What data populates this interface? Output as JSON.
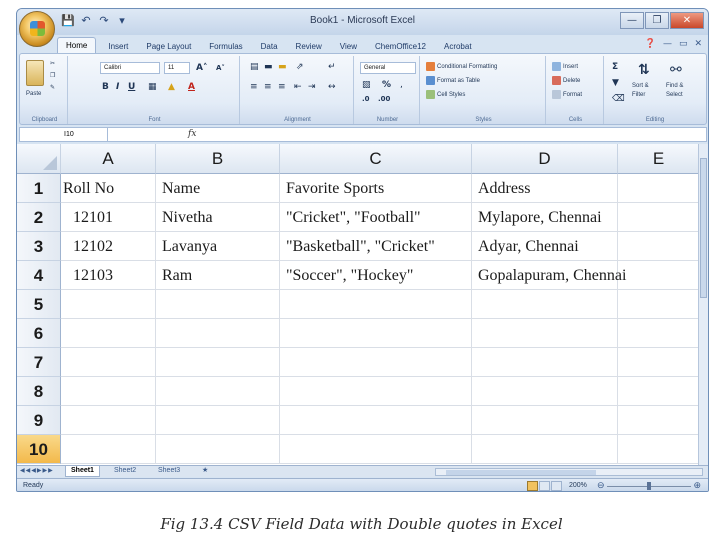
{
  "window": {
    "title": "Book1 - Microsoft Excel",
    "controls": [
      "minimize-icon",
      "restore-icon",
      "close-icon"
    ]
  },
  "ribbon_tabs": [
    "Home",
    "Insert",
    "Page Layout",
    "Formulas",
    "Data",
    "Review",
    "View",
    "ChemOffice12",
    "Acrobat"
  ],
  "ribbon": {
    "clipboard": {
      "label": "Clipboard",
      "paste": "Paste"
    },
    "font": {
      "label": "Font",
      "name": "Calibri",
      "size": "11"
    },
    "alignment": {
      "label": "Alignment"
    },
    "number": {
      "label": "Number",
      "format": "General",
      "percent": "%"
    },
    "styles": {
      "label": "Styles",
      "conditional": "Conditional Formatting",
      "format_table": "Format as Table",
      "cell_styles": "Cell Styles"
    },
    "cells": {
      "label": "Cells",
      "insert": "Insert",
      "delete": "Delete",
      "format": "Format"
    },
    "editing": {
      "label": "Editing",
      "sort": "Sort &",
      "filter": "Filter",
      "find": "Find &",
      "select": "Select"
    }
  },
  "formula_bar": {
    "name_box": "I10",
    "fx": "fx",
    "value": ""
  },
  "columns": [
    "A",
    "B",
    "C",
    "D",
    "E"
  ],
  "rows": [
    "1",
    "2",
    "3",
    "4",
    "5",
    "6",
    "7",
    "8",
    "9",
    "10"
  ],
  "active_row": "10",
  "cells": [
    [
      "Roll No",
      "Name",
      "Favorite Sports",
      "Address",
      ""
    ],
    [
      "12101",
      "Nivetha",
      "\"Cricket\", \"Football\"",
      "Mylapore, Chennai",
      ""
    ],
    [
      "12102",
      "Lavanya",
      "\"Basketball\", \"Cricket\"",
      "Adyar, Chennai",
      ""
    ],
    [
      "12103",
      "Ram",
      "\"Soccer\", \"Hockey\"",
      "Gopalapuram, Chennai",
      ""
    ]
  ],
  "sheet_tabs": [
    "Sheet1",
    "Sheet2",
    "Sheet3"
  ],
  "active_sheet": "Sheet1",
  "status": {
    "ready": "Ready",
    "zoom": "200%"
  },
  "caption": "Fig 13.4 CSV Field Data with Double quotes in Excel"
}
